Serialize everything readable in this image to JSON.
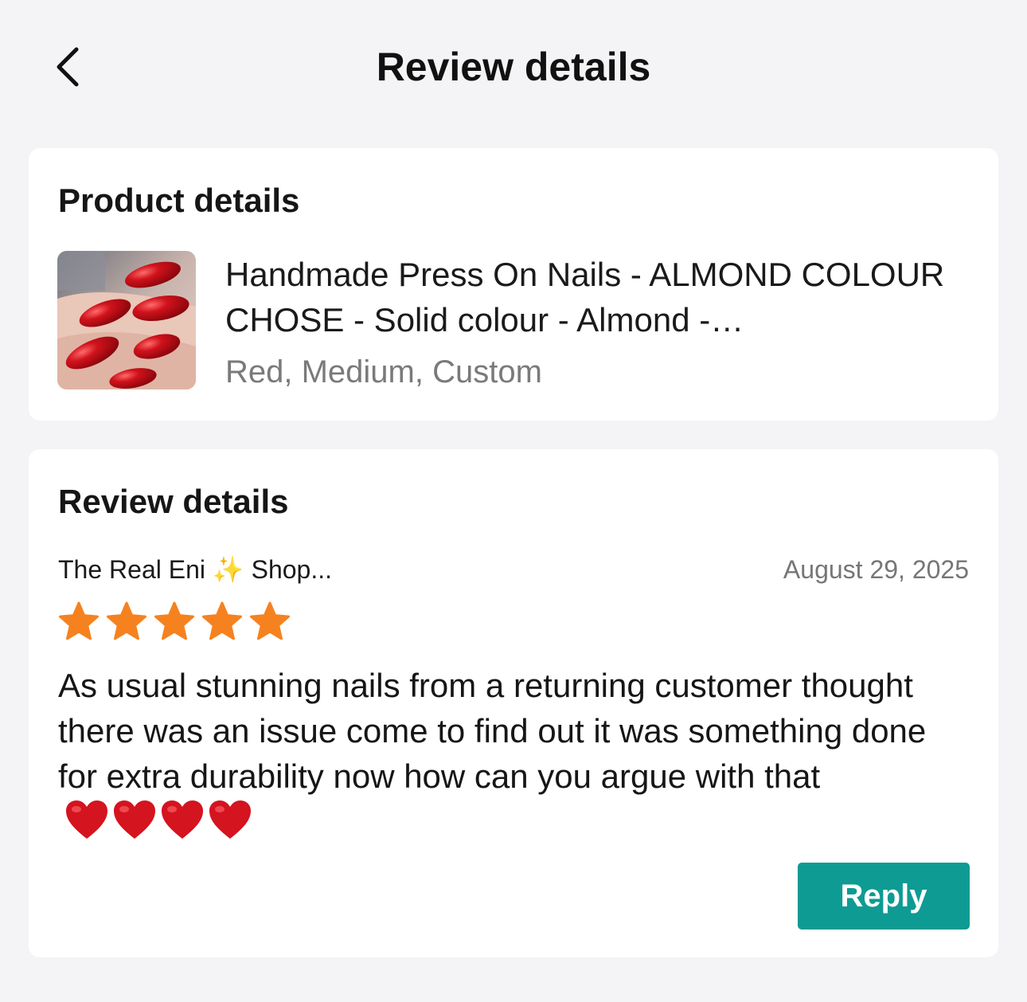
{
  "header": {
    "title": "Review details",
    "back_icon": "chevron-left-icon"
  },
  "product": {
    "section_title": "Product details",
    "name": "Handmade Press On Nails - ALMOND COLOUR CHOSE - Solid colour - Almond -…",
    "variant": "Red, Medium, Custom"
  },
  "review": {
    "section_title": "Review details",
    "reviewer": "The Real Eni ✨ Shop...",
    "date": "August 29, 2025",
    "rating": 5,
    "rating_max": 5,
    "star_color": "#f5821f",
    "text": "As usual stunning nails from a returning customer thought there was an issue come to find out it was something done for extra durability now how can you argue with that",
    "emoji": "❤️❤️❤️❤️",
    "reply_label": "Reply",
    "reply_color": "#0e9b93"
  }
}
